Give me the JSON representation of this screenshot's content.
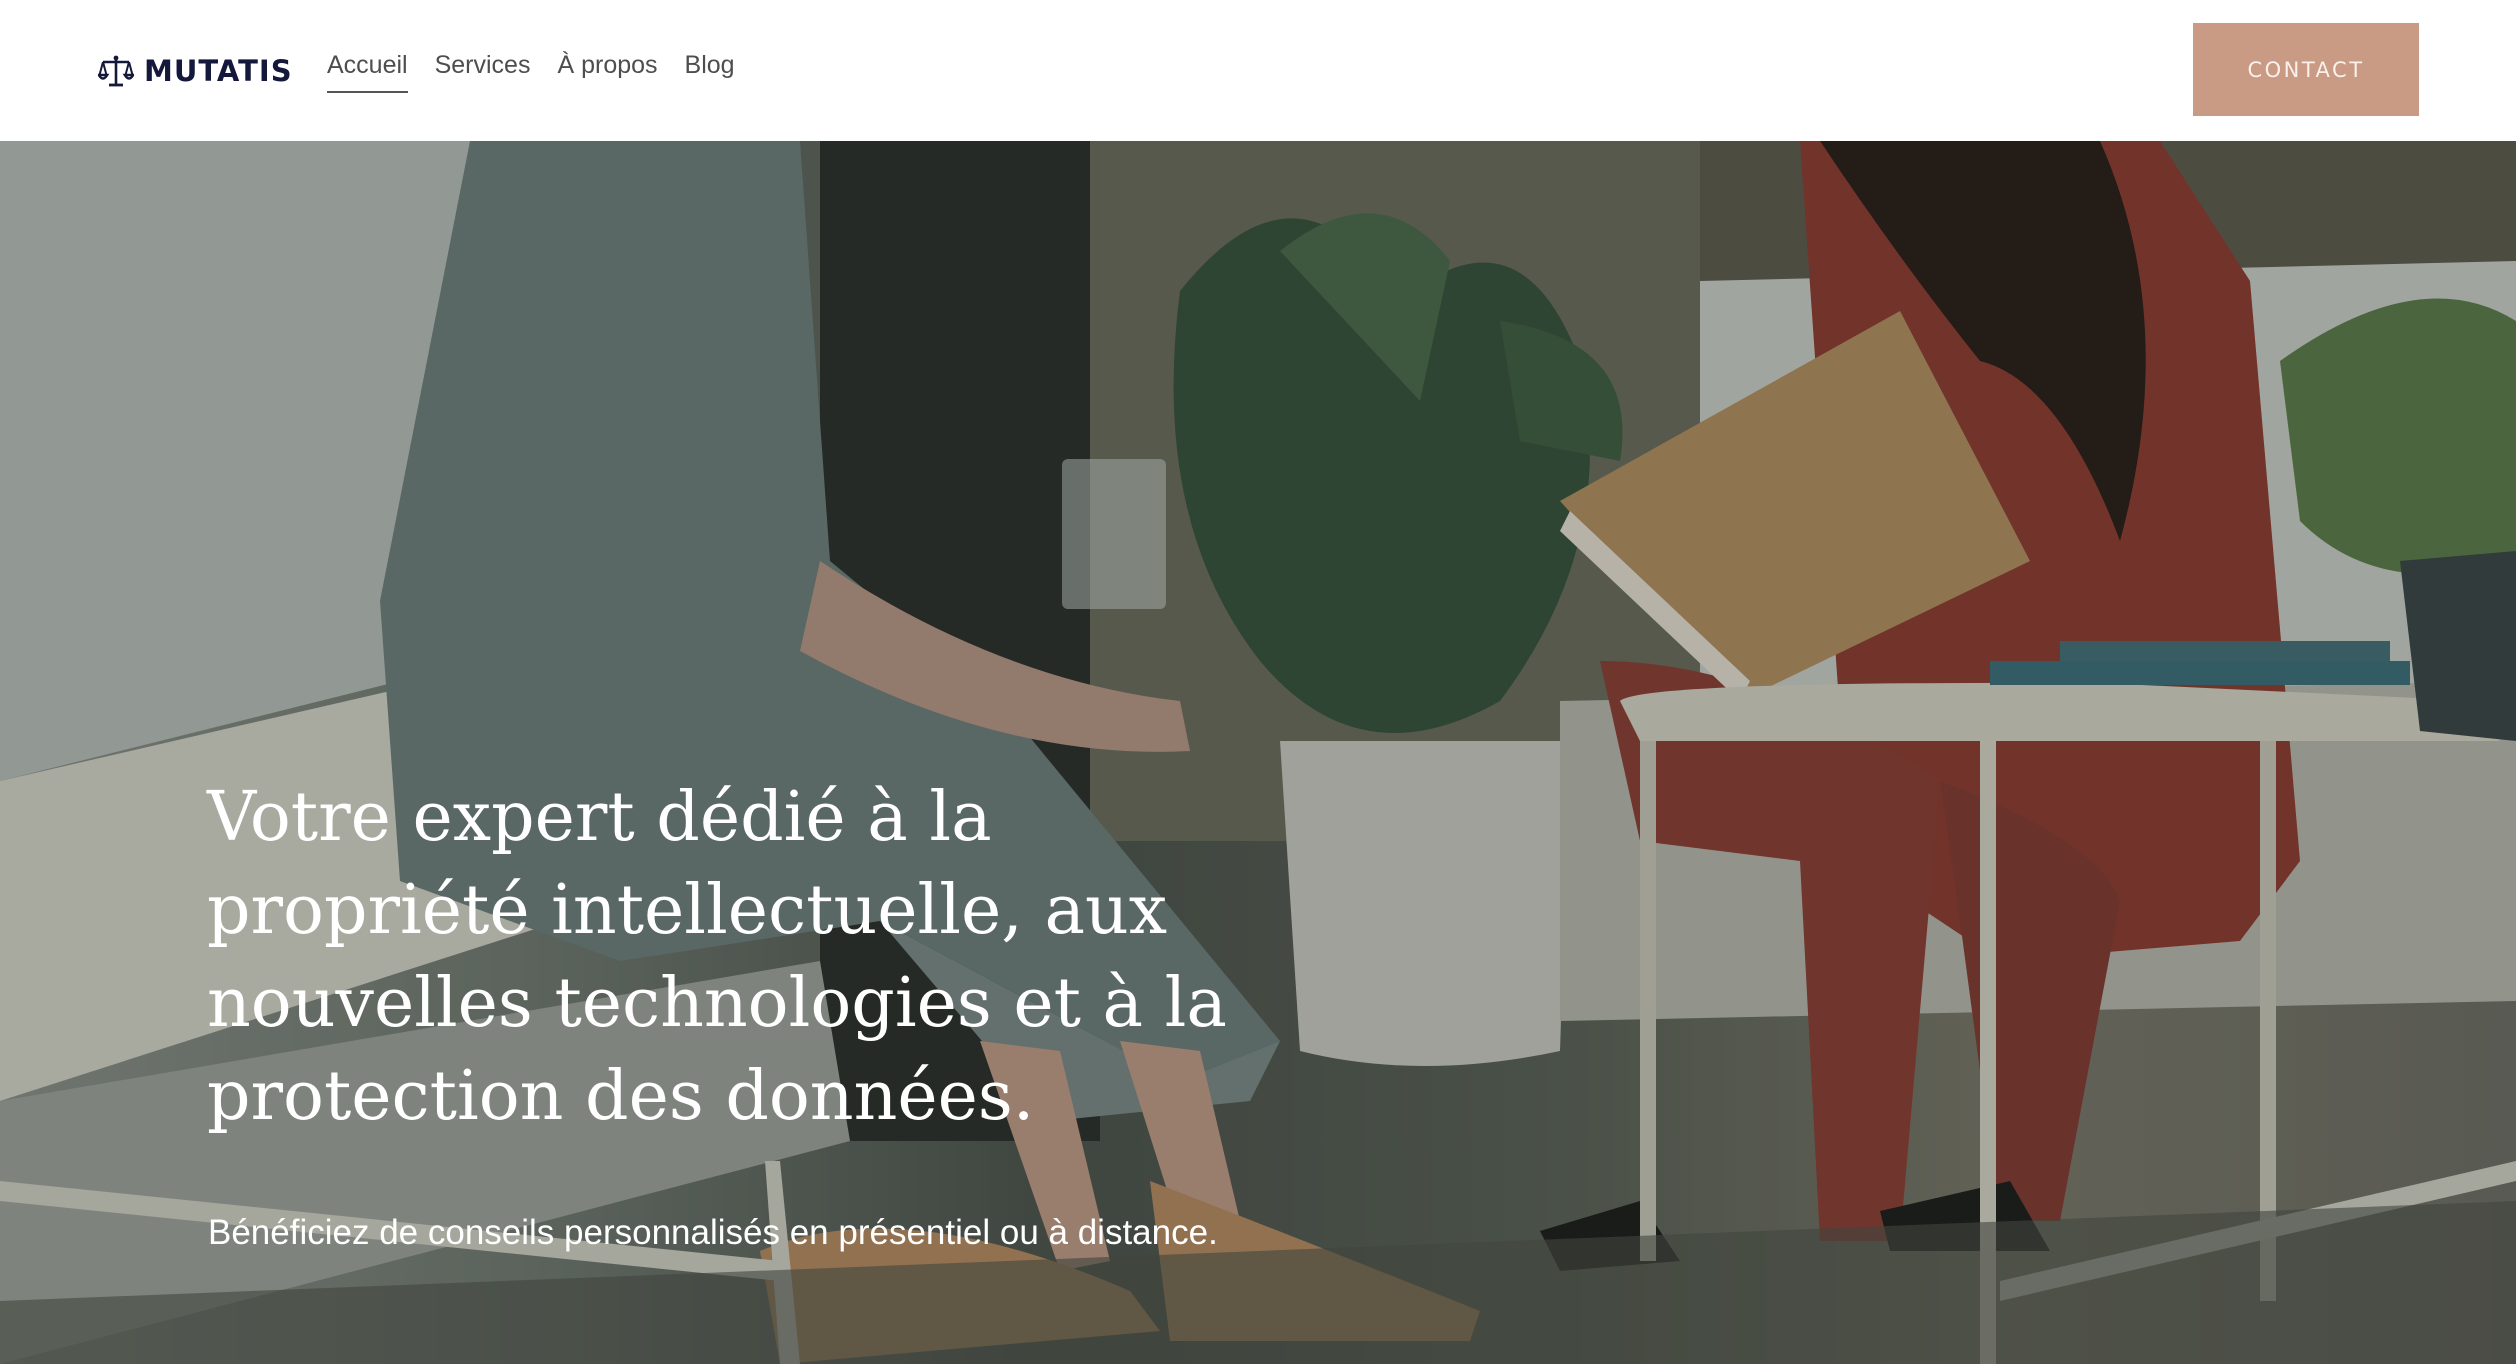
{
  "header": {
    "logo_text": "MUTATIS",
    "logo_icon": "scales-icon",
    "nav": [
      {
        "label": "Accueil",
        "active": true
      },
      {
        "label": "Services",
        "active": false
      },
      {
        "label": "À propos",
        "active": false
      },
      {
        "label": "Blog",
        "active": false
      }
    ],
    "contact_label": "CONTACT"
  },
  "hero": {
    "title": "Votre expert dédié à la propriété intellectuelle, aux nouvelles technologies et à la protection des données.",
    "subtitle": "Bénéficiez de conseils personnalisés en présentiel ou à distance."
  },
  "colors": {
    "accent": "#c99a84",
    "logo": "#14183a",
    "nav_text": "#4e4e4e",
    "hero_text": "#ffffff"
  }
}
